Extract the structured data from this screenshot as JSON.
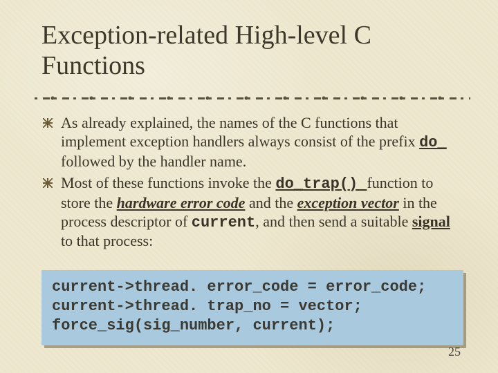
{
  "title": "Exception-related High-level C Functions",
  "bullets": {
    "b1": {
      "pre": "As already explained, the names of the C functions that implement exception handlers always consist of the prefix ",
      "code": "do_ ",
      "post": "followed by the handler name."
    },
    "b2": {
      "a": "Most of these functions invoke the ",
      "code1": "do_trap() ",
      "b": "function to store the ",
      "hw": "hardware error code",
      "c": " and the ",
      "ev": "exception vector",
      "d": " in the process descriptor of ",
      "cur": "current",
      "e": ", and then send a suitable ",
      "sig": "signal",
      "f": " to that process:"
    }
  },
  "code": {
    "l1": "current->thread. error_code = error_code;",
    "l2": "current->thread. trap_no = vector;",
    "l3": "force_sig(sig_number, current);"
  },
  "page_number": "25"
}
